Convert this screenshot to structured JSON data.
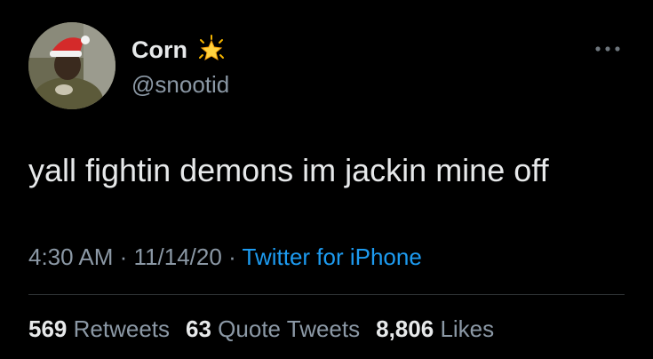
{
  "author": {
    "display_name": "Corn",
    "handle": "@snootid",
    "name_emoji_icon": "glowing-star-icon",
    "avatar_icon": "avatar-santa-hat"
  },
  "tweet": {
    "text": "yall fightin demons im jackin mine off",
    "time": "4:30 AM",
    "date": "11/14/20",
    "separator": "·",
    "source": "Twitter for iPhone"
  },
  "stats": {
    "retweets_count": "569",
    "retweets_label": "Retweets",
    "quotes_count": "63",
    "quotes_label": "Quote Tweets",
    "likes_count": "8,806",
    "likes_label": "Likes"
  },
  "colors": {
    "background": "#000000",
    "primary_text": "#e7e9ea",
    "secondary_text": "#8b98a5",
    "link": "#1d9bf0",
    "divider": "#2f3336"
  },
  "icons": {
    "more": "more-horizontal-icon"
  }
}
